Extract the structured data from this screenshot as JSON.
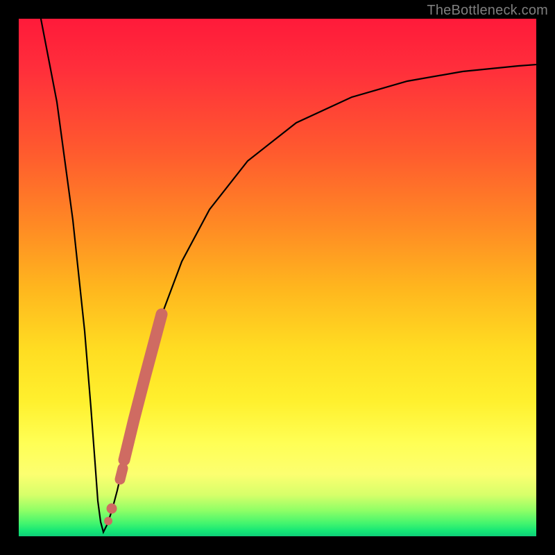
{
  "watermark": "TheBottleneck.com",
  "colors": {
    "frame": "#000000",
    "curve": "#000000",
    "highlight": "#cf6b62"
  },
  "chart_data": {
    "type": "line",
    "title": "",
    "xlabel": "",
    "ylabel": "",
    "xlim": [
      0,
      100
    ],
    "ylim": [
      0,
      100
    ],
    "series": [
      {
        "name": "bottleneck-curve",
        "x": [
          4,
          6,
          8,
          10,
          12,
          13.5,
          14.5,
          16,
          18,
          20,
          22,
          24,
          26,
          28,
          30,
          34,
          40,
          48,
          56,
          66,
          78,
          90,
          100
        ],
        "y": [
          100,
          78,
          56,
          34,
          14,
          4,
          1,
          4,
          14,
          27,
          38,
          48,
          56,
          63,
          68,
          76,
          82,
          87,
          90,
          92.5,
          93.8,
          94.5,
          94.8
        ]
      }
    ],
    "highlight_segment": {
      "description": "thick salmon overlay on rising branch near minimum",
      "points": [
        {
          "x": 17.5,
          "y": 4.5
        },
        {
          "x": 18.3,
          "y": 6.3
        },
        {
          "x": 19.0,
          "y": 8.0
        },
        {
          "x": 22.0,
          "y": 22.0
        },
        {
          "x": 25.0,
          "y": 36.0
        },
        {
          "x": 27.0,
          "y": 44.0
        }
      ]
    },
    "minimum": {
      "x": 14.5,
      "y": 1
    }
  }
}
